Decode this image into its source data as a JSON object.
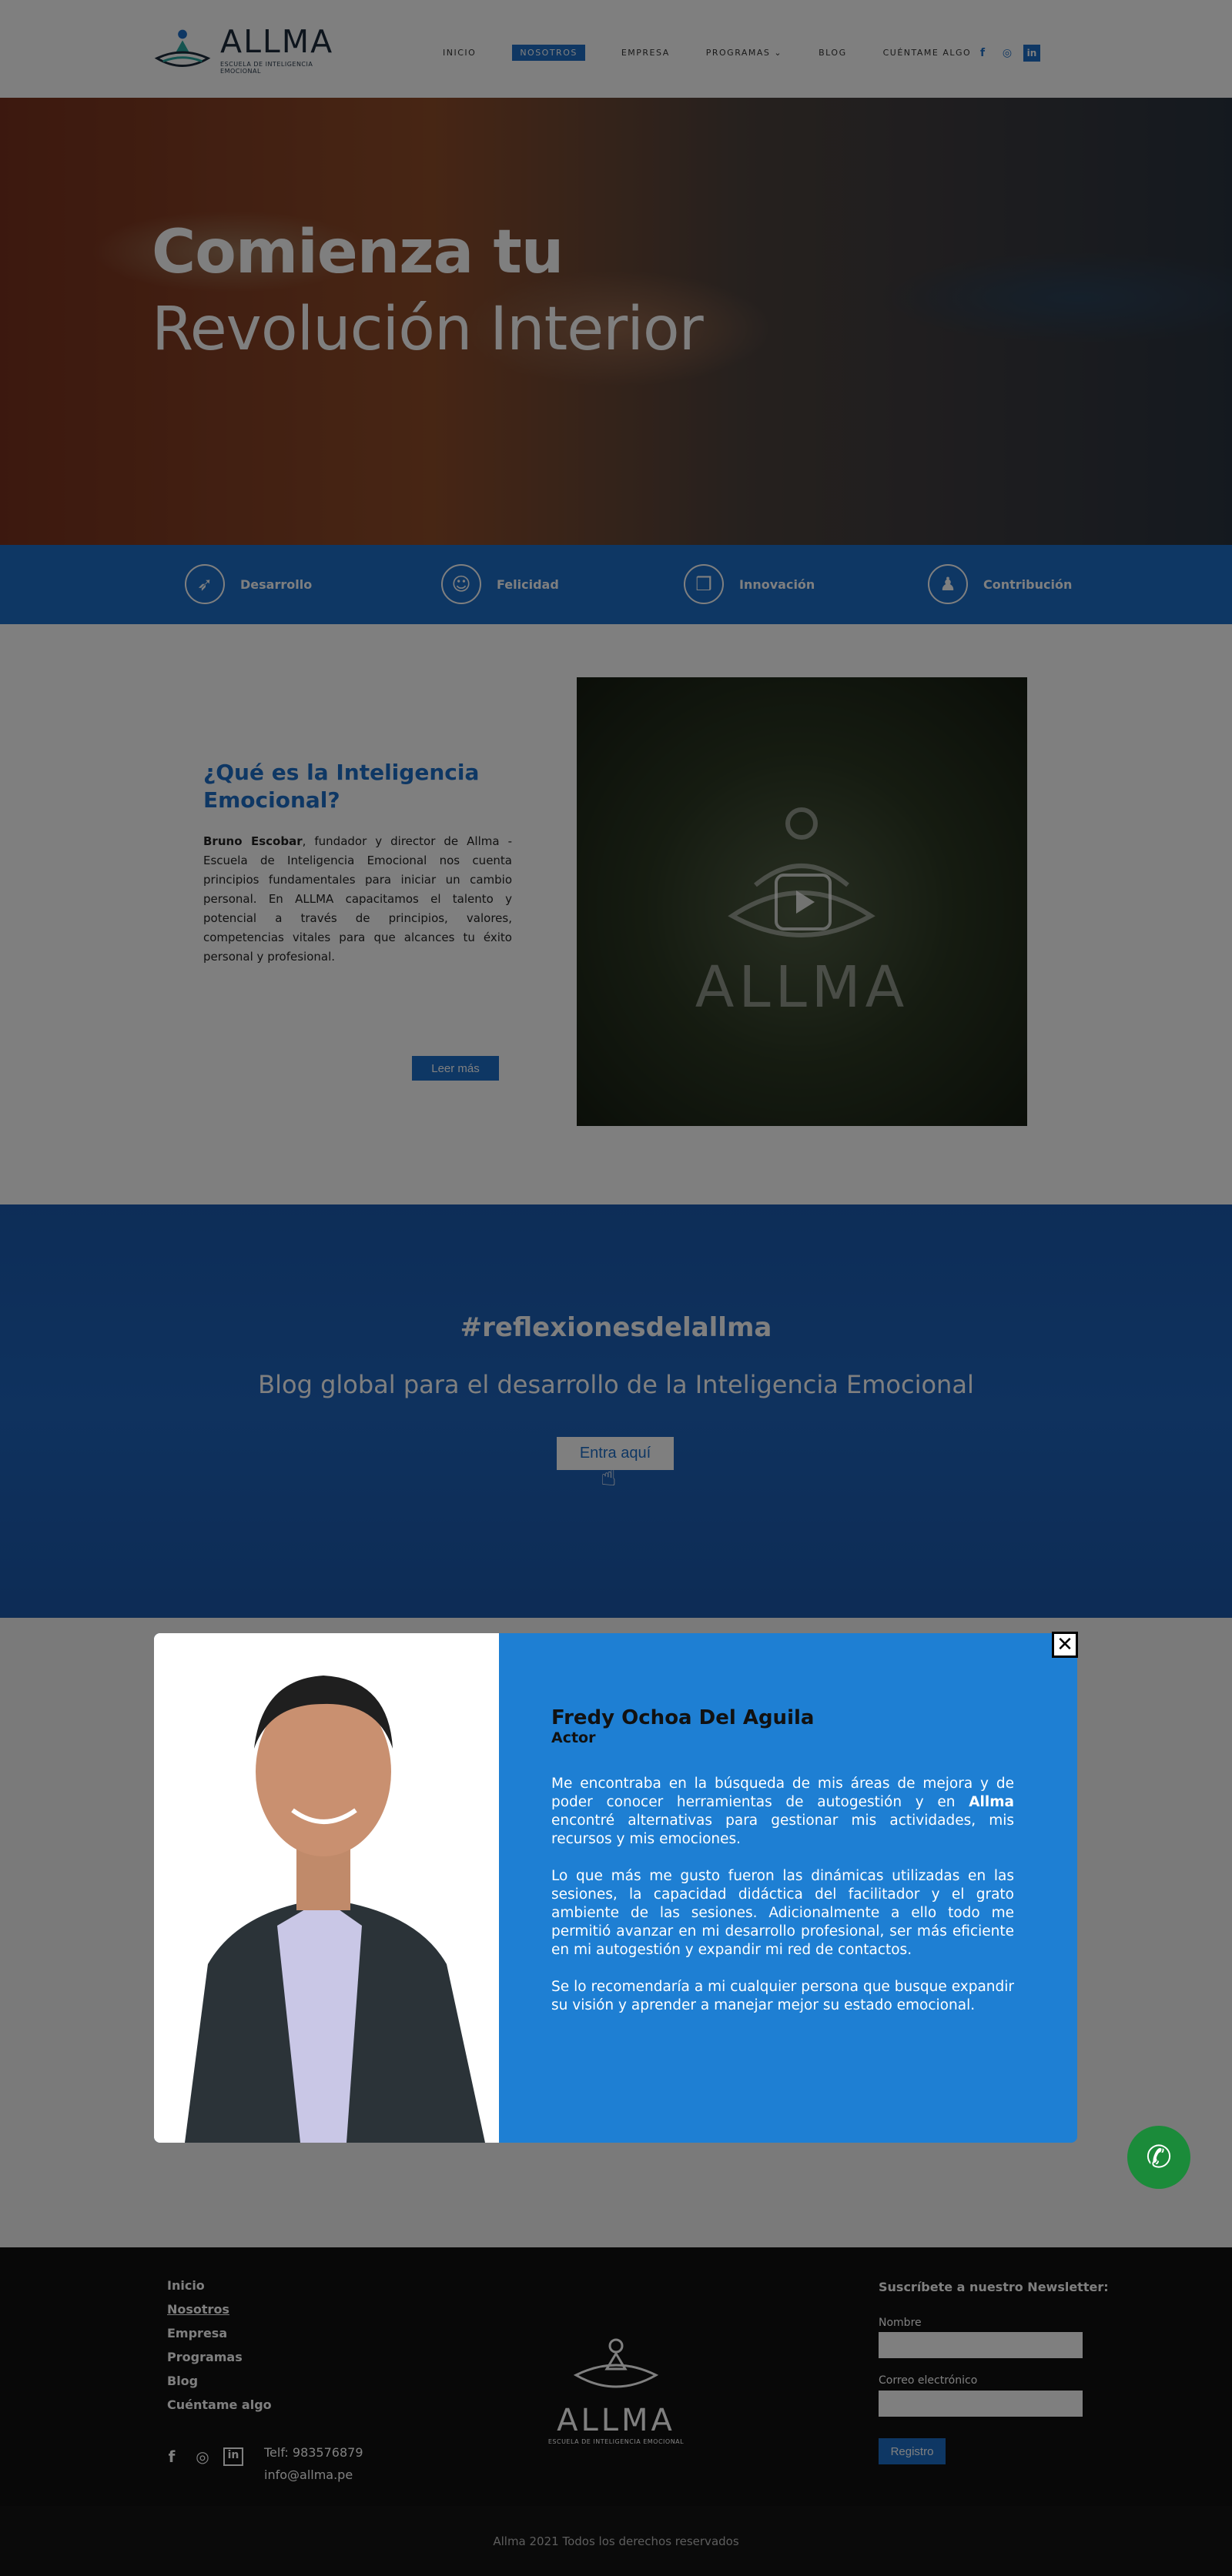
{
  "header": {
    "logo_name": "ALLMA",
    "logo_sub": "ESCUELA DE INTELIGENCIA EMOCIONAL",
    "nav": [
      "INICIO",
      "NOSOTROS",
      "EMPRESA",
      "PROGRAMAS",
      "BLOG",
      "CUÉNTAME ALGO"
    ],
    "active_nav": "NOSOTROS",
    "social": [
      "facebook-icon",
      "instagram-icon",
      "linkedin-icon"
    ]
  },
  "hero": {
    "line1": "Comienza tu",
    "line2": "Revolución Interior"
  },
  "features": [
    "Desarrollo",
    "Felicidad",
    "Innovación",
    "Contribución"
  ],
  "about": {
    "title": "¿Qué es la Inteligencia Emocional?",
    "author": "Bruno Escobar",
    "text": ", fundador y director de Allma - Escuela de Inteligencia Emocional nos cuenta principios fundamentales para iniciar un cambio personal. En ALLMA capacitamos el talento y potencial a través de principios, valores, competencias vitales para que alcances tu éxito personal y profesional.",
    "button": "Leer más",
    "video_logo": "ALLMA"
  },
  "blog": {
    "hashtag": "#reflexionesdelallma",
    "subtitle": "Blog global para el desarrollo de la Inteligencia Emocional",
    "button": "Entra aquí"
  },
  "modal": {
    "name": "Fredy Ochoa Del Aguila",
    "role": "Actor",
    "p1_a": "Me encontraba en la búsqueda de mis áreas de mejora y de poder conocer herramientas de autogestión y en ",
    "p1_b": "Allma",
    "p1_c": " encontré alternativas para gestionar mis actividades, mis recursos y mis emociones.",
    "p2": "Lo que más me gusto fueron las dinámicas utilizadas en las sesiones, la capacidad didáctica del facilitador y el grato ambiente de las sesiones. Adicionalmente a ello todo me permitió avanzar en mi desarrollo profesional, ser más eficiente en mi autogestión y expandir mi red de contactos.",
    "p3": "Se lo recomendaría a mi cualquier persona que busque expandir su visión y aprender a manejar mejor su estado emocional.",
    "close": "✕"
  },
  "footer": {
    "links": [
      "Inicio",
      "Nosotros",
      "Empresa",
      "Programas",
      "Blog",
      "Cuéntame algo"
    ],
    "phone": "Telf: 983576879",
    "email": "info@allma.pe",
    "logo_name": "ALLMA",
    "logo_sub": "ESCUELA DE INTELIGENCIA EMOCIONAL",
    "newsletter_title": "Suscríbete a nuestro Newsletter:",
    "name_label": "Nombre",
    "email_label": "Correo electrónico",
    "register": "Registro",
    "copyright": "Allma 2021 Todos los derechos reservados"
  },
  "colors": {
    "brand_blue": "#1d6fc9",
    "modal_blue": "#1e7fd3",
    "whatsapp": "#1b8b3a"
  }
}
